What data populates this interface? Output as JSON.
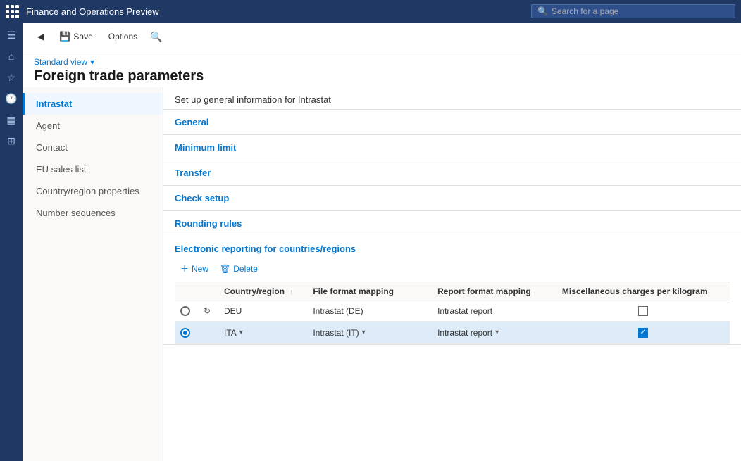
{
  "app": {
    "title": "Finance and Operations Preview",
    "search_placeholder": "Search for a page"
  },
  "toolbar": {
    "back_label": "",
    "save_label": "Save",
    "options_label": "Options",
    "search_label": ""
  },
  "page": {
    "view_label": "Standard view",
    "title": "Foreign trade parameters",
    "subtitle": "Set up general information for Intrastat"
  },
  "left_nav": {
    "items": [
      {
        "id": "intrastat",
        "label": "Intrastat",
        "active": true
      },
      {
        "id": "agent",
        "label": "Agent",
        "active": false
      },
      {
        "id": "contact",
        "label": "Contact",
        "active": false
      },
      {
        "id": "eu-sales",
        "label": "EU sales list",
        "active": false
      },
      {
        "id": "country-region",
        "label": "Country/region properties",
        "active": false
      },
      {
        "id": "number-sequences",
        "label": "Number sequences",
        "active": false
      }
    ]
  },
  "sections": [
    {
      "id": "general",
      "label": "General"
    },
    {
      "id": "minimum-limit",
      "label": "Minimum limit"
    },
    {
      "id": "transfer",
      "label": "Transfer"
    },
    {
      "id": "check-setup",
      "label": "Check setup"
    },
    {
      "id": "rounding-rules",
      "label": "Rounding rules"
    }
  ],
  "er_section": {
    "title": "Electronic reporting for countries/regions",
    "new_button": "New",
    "delete_button": "Delete",
    "table": {
      "columns": [
        {
          "id": "radio",
          "label": ""
        },
        {
          "id": "refresh",
          "label": ""
        },
        {
          "id": "country",
          "label": "Country/region",
          "sortable": true
        },
        {
          "id": "file",
          "label": "File format mapping"
        },
        {
          "id": "report",
          "label": "Report format mapping"
        },
        {
          "id": "misc",
          "label": "Miscellaneous charges per kilogram"
        }
      ],
      "rows": [
        {
          "selected": false,
          "country": "DEU",
          "file_mapping": "Intrastat (DE)",
          "report_mapping": "Intrastat report",
          "misc_checked": false
        },
        {
          "selected": true,
          "country": "ITA",
          "file_mapping": "Intrastat (IT)",
          "report_mapping": "Intrastat report",
          "misc_checked": true
        }
      ]
    }
  }
}
